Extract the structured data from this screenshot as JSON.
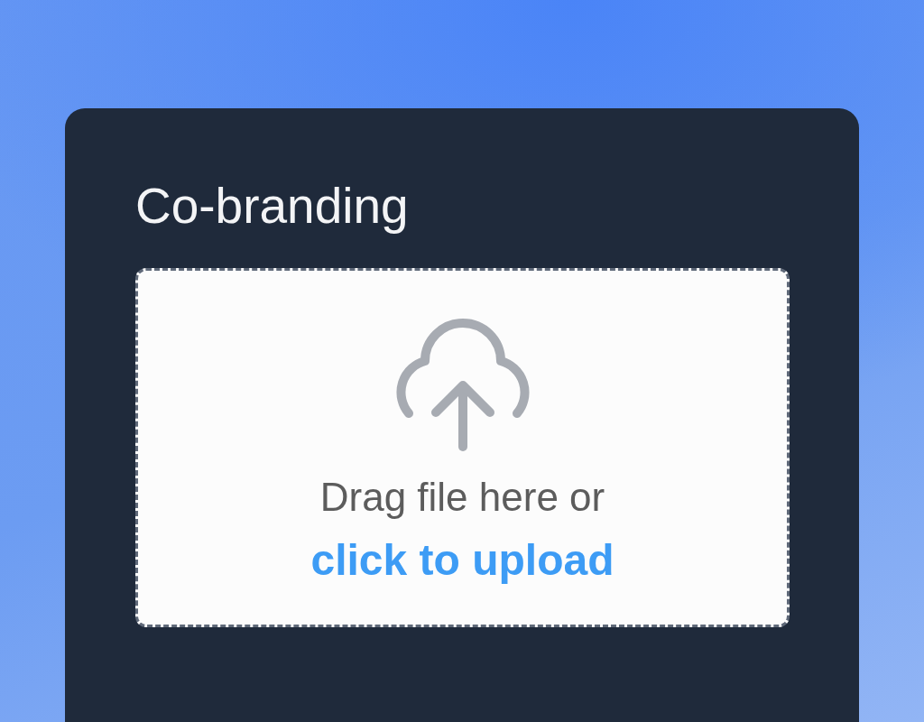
{
  "card": {
    "title": "Co-branding"
  },
  "upload": {
    "prompt": "Drag file here or",
    "link": "click to upload"
  }
}
